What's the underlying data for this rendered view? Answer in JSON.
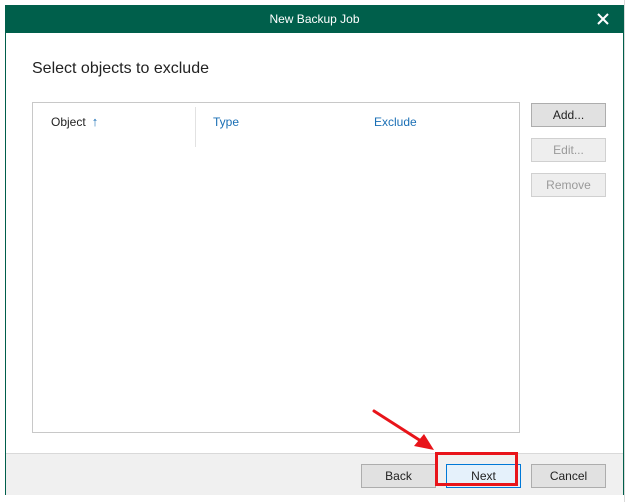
{
  "window": {
    "title": "New Backup Job"
  },
  "page": {
    "heading": "Select objects to exclude"
  },
  "table": {
    "columns": [
      "Object",
      "Type",
      "Exclude"
    ],
    "sort_column": "Object",
    "rows": []
  },
  "side_buttons": {
    "add": "Add...",
    "edit": "Edit...",
    "remove": "Remove"
  },
  "footer": {
    "back": "Back",
    "next": "Next",
    "cancel": "Cancel"
  },
  "colors": {
    "titlebar": "#005f4b",
    "link_blue": "#1a6fb5",
    "annotation_red": "#e8141a"
  },
  "icons": {
    "close": "close-icon",
    "sort": "sort-ascending-icon",
    "annotation": "annotation-arrow-icon"
  }
}
